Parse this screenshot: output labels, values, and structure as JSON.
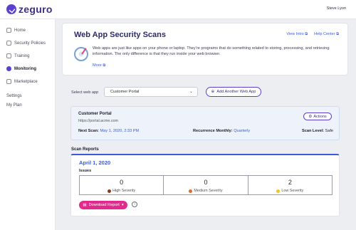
{
  "header": {
    "brand": "zeguro",
    "user_name": "Steve Lyon"
  },
  "sidebar": {
    "items": [
      {
        "label": "Home",
        "icon": "home-icon"
      },
      {
        "label": "Security Policies",
        "icon": "shield-icon"
      },
      {
        "label": "Training",
        "icon": "training-icon"
      },
      {
        "label": "Monitoring",
        "icon": "monitoring-icon",
        "active": true
      },
      {
        "label": "Marketplace",
        "icon": "marketplace-icon"
      }
    ],
    "settings_label": "Settings",
    "plan_label": "My Plan"
  },
  "intro": {
    "title": "Web App Security Scans",
    "view_intro_label": "View Intro",
    "help_center_label": "Help Center",
    "description": "Web apps are just like apps on your phone or laptop. They’re programs that do something related to storing, processing, and retrieving information. The only difference is that they run inside your web browser.",
    "more_label": "More"
  },
  "web_app_select": {
    "label": "Select web app",
    "selected": "Customer Portal",
    "add_button_label": "Add Another Web App"
  },
  "portal": {
    "name": "Customer Portal",
    "url": "https://portal.acme.com",
    "actions_label": "Actions",
    "next_scan_label": "Next Scan:",
    "next_scan_value": "May 1, 2020, 2:33 PM",
    "recurrence_label": "Recurrence Monthly:",
    "recurrence_value": "Quarterly",
    "scan_level_label": "Scan Level:",
    "scan_level_value": "Safe"
  },
  "scan_reports": {
    "heading": "Scan Reports",
    "date": "April 1, 2020",
    "issues_label": "Issues",
    "severities": [
      {
        "count": "0",
        "label": "High Severity",
        "color": "#8b3a1f"
      },
      {
        "count": "0",
        "label": "Medium Severity",
        "color": "#e06a2a"
      },
      {
        "count": "2",
        "label": "Low Severity",
        "color": "#f2c230"
      }
    ],
    "download_label": "Download Report"
  }
}
